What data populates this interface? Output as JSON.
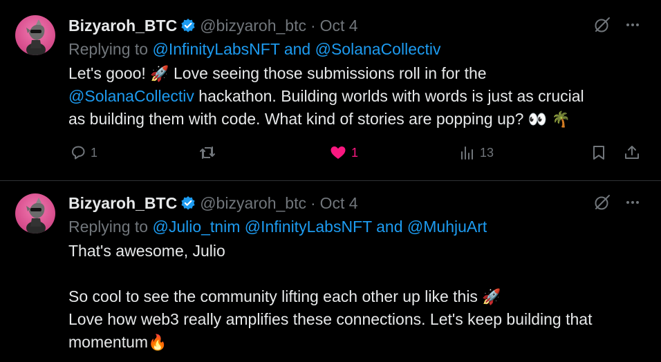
{
  "tweets": [
    {
      "name": "Bizyaroh_BTC",
      "handle": "@bizyaroh_btc",
      "date": "Oct 4",
      "replying_prefix": "Replying to ",
      "replying_mentions": "@InfinityLabsNFT and @SolanaCollectiv",
      "body_lines": [
        {
          "pre": "Let's gooo! ",
          "emoji": "🚀",
          "post": " Love seeing those submissions roll in for the"
        },
        {
          "mention": "@SolanaCollectiv",
          "post": " hackathon. Building worlds with words is just as crucial"
        },
        {
          "pre": "as building them with code. What kind of stories are popping up? ",
          "emoji": "👀",
          "emoji2": "🌴"
        }
      ],
      "stats": {
        "replies": "1",
        "retweets": "",
        "likes": "1",
        "views": "13"
      }
    },
    {
      "name": "Bizyaroh_BTC",
      "handle": "@bizyaroh_btc",
      "date": "Oct 4",
      "replying_prefix": "Replying to ",
      "replying_mentions": "@Julio_tnim @InfinityLabsNFT and @MuhjuArt",
      "body_lines": [
        {
          "pre": "That's awesome, Julio"
        },
        {
          "pre": ""
        },
        {
          "pre": "So cool to see the community lifting each other up like this ",
          "emoji": "🚀"
        },
        {
          "pre": "Love how web3 really amplifies these connections. Let's keep building that"
        },
        {
          "pre": "momentum",
          "emoji": "🔥"
        }
      ]
    }
  ],
  "colors": {
    "accent": "#1d9bf0",
    "like": "#f91880",
    "muted": "#71767b",
    "text": "#e7e9ea"
  },
  "icons": [
    "verified-badge-icon",
    "grok-icon",
    "more-icon",
    "reply-icon",
    "retweet-icon",
    "like-icon",
    "views-icon",
    "bookmark-icon",
    "share-icon"
  ]
}
